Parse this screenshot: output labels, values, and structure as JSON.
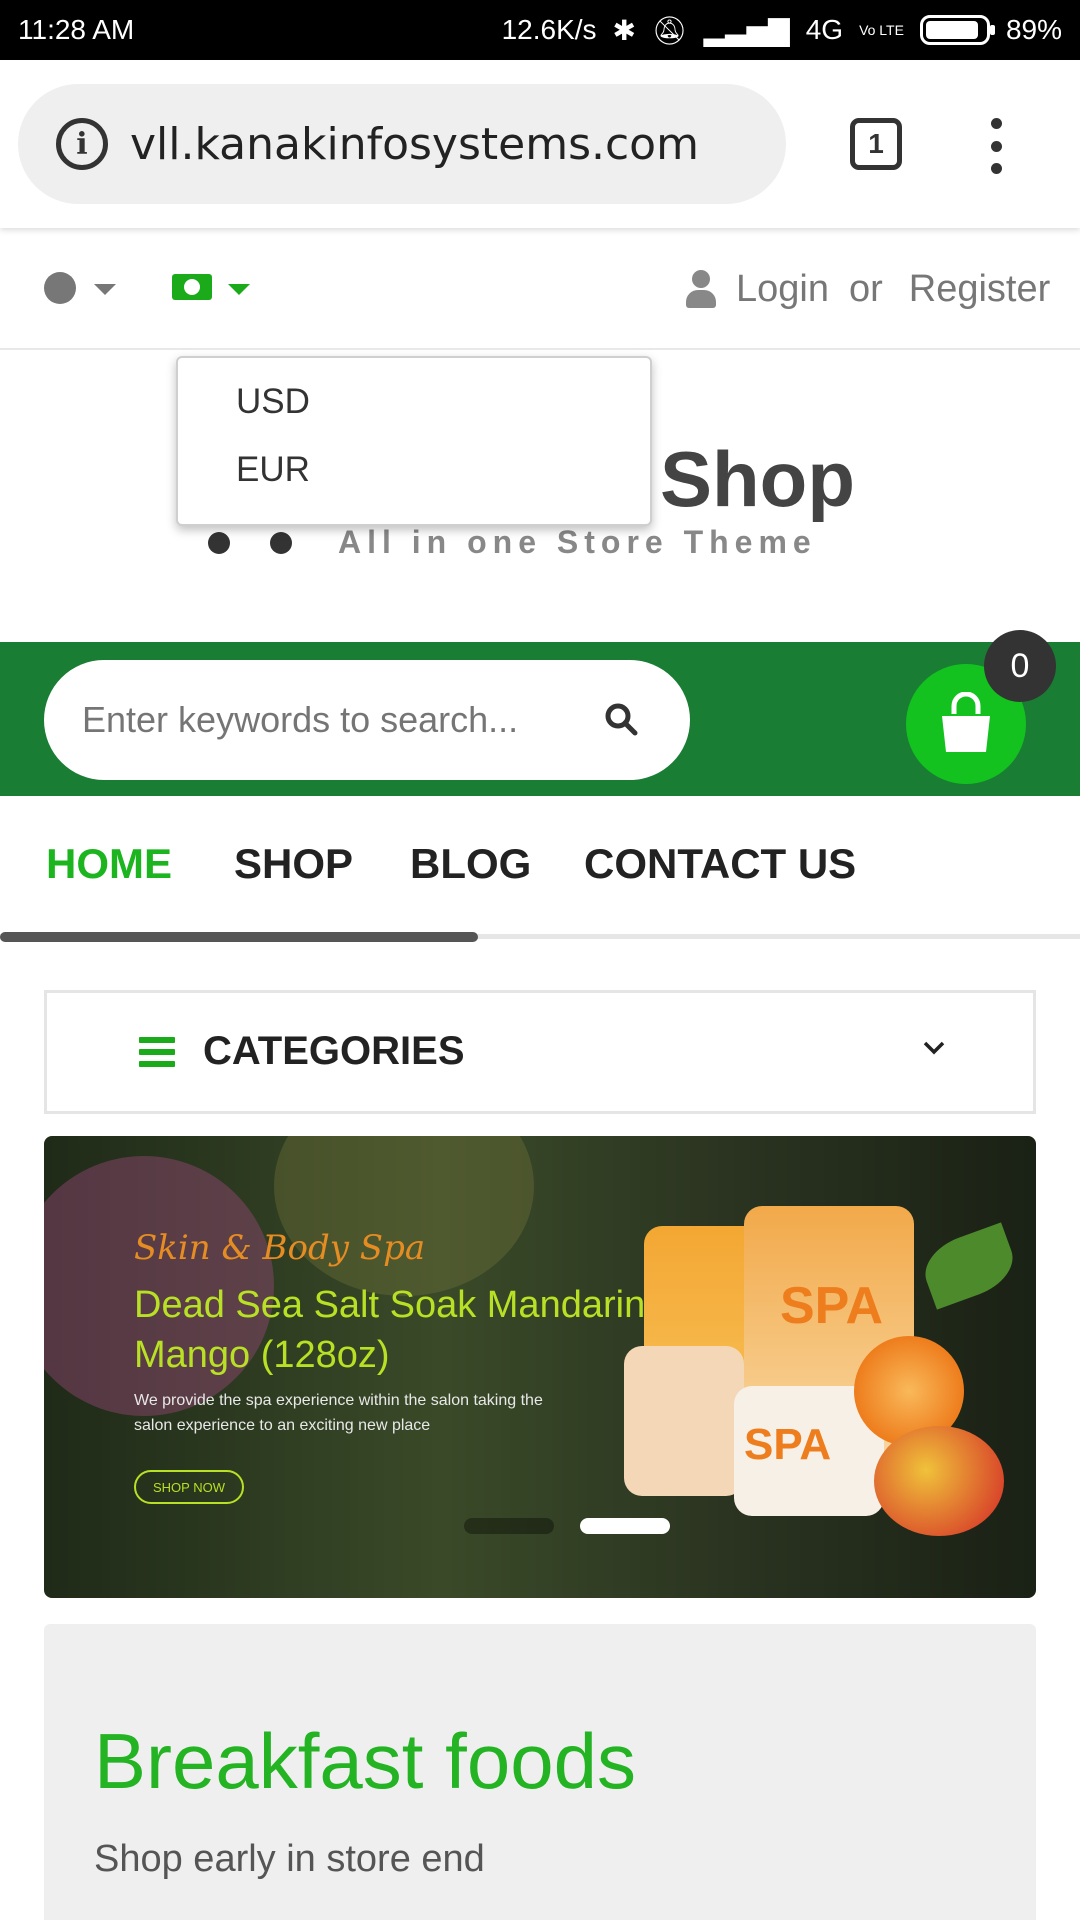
{
  "status_bar": {
    "time": "11:28 AM",
    "network_speed": "12.6K/s",
    "network_type": "4G",
    "volte": "Vo LTE",
    "battery": "89%",
    "battery_level": 0.89
  },
  "browser": {
    "url": "vll.kanakinfosystems.com",
    "tab_count": "1"
  },
  "top_bar": {
    "login_label": "Login",
    "or_label": "or",
    "register_label": "Register"
  },
  "currency_dropdown": {
    "options": [
      "USD",
      "EUR"
    ]
  },
  "logo": {
    "main_text": "Shop",
    "subtitle": "All in one Store Theme"
  },
  "search": {
    "placeholder": "Enter keywords to search..."
  },
  "cart": {
    "count": "0"
  },
  "nav": {
    "items": [
      {
        "label": "HOME",
        "active": true
      },
      {
        "label": "SHOP",
        "active": false
      },
      {
        "label": "BLOG",
        "active": false
      },
      {
        "label": "CONTACT US",
        "active": false
      }
    ],
    "scroll_fraction": 0.44
  },
  "categories": {
    "label": "CATEGORIES"
  },
  "banner": {
    "tagline": "Skin & Body Spa",
    "headline": "Dead Sea Salt Soak Mandarin Mango (128oz)",
    "description": "We provide the spa experience within the salon taking the salon experience to an exciting new place",
    "cta": "SHOP NOW",
    "product_brand": "SPA",
    "slide_count": 2,
    "active_slide": 2
  },
  "promo": {
    "title": "Breakfast foods",
    "subtitle": "Shop early in store end"
  },
  "colors": {
    "brand_green": "#1db51f",
    "search_band": "#1a7d34",
    "cart_green": "#13c21f",
    "banner_headline": "#b8e024",
    "banner_tagline": "#e58c22"
  }
}
